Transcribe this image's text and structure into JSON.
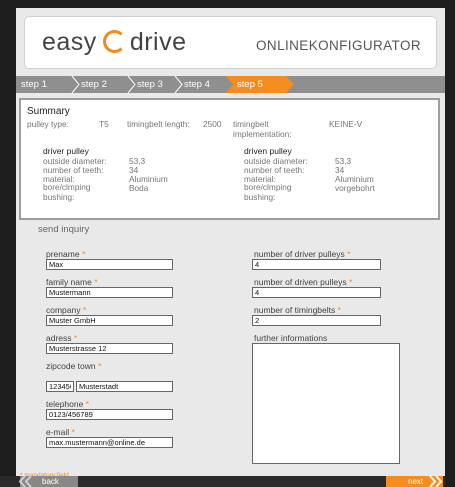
{
  "header": {
    "logo_left": "easy",
    "logo_right": "drive",
    "subtitle": "ONLINEKONFIGURATOR"
  },
  "steps": [
    "step 1",
    "step 2",
    "step 3",
    "step 4",
    "step 5"
  ],
  "active_step": "step 5",
  "summary": {
    "title": "Summary",
    "pulley_type_label": "pulley type:",
    "pulley_type_value": "T5",
    "belt_length_label": "timingbelt length:",
    "belt_length_value": "2500",
    "belt_impl_label": "timingbelt implementation:",
    "belt_impl_value": "KEINE-V",
    "driver": {
      "title": "driver pulley",
      "outside_diameter_label": "outside diameter:",
      "outside_diameter_value": "53,3",
      "teeth_label": "number of teeth:",
      "teeth_value": "34",
      "material_label": "material:",
      "material_value": "Aluminium",
      "bore_label": "bore/clmping bushing:",
      "bore_value": "Boda"
    },
    "driven": {
      "title": "driven pulley",
      "outside_diameter_label": "outside diameter:",
      "outside_diameter_value": "53,3",
      "teeth_label": "number of teeth:",
      "teeth_value": "34",
      "material_label": "material:",
      "material_value": "Aluminium",
      "bore_label": "bore/clmping bushing:",
      "bore_value": "vorgebohrt"
    }
  },
  "inquiry": {
    "title": "send inquiry",
    "required_mark": "*",
    "prename_label": "prename",
    "prename_value": "Max",
    "family_name_label": "family name",
    "family_name_value": "Mustermann",
    "company_label": "company",
    "company_value": "Muster GmbH",
    "address_label": "adress",
    "address_value": "Musterstrasse 12",
    "zip_town_label": "zipcode  town",
    "zip_value": "123456",
    "town_value": "Musterstadt",
    "telephone_label": "telephone",
    "telephone_value": "0123/456789",
    "email_label": "e-mail",
    "email_value": "max.mustermann@online.de",
    "driver_pulleys_label": "number of driver pulleys",
    "driver_pulleys_value": "4",
    "driven_pulleys_label": "number of driven pulleys",
    "driven_pulleys_value": "4",
    "timingbelts_label": "number of timingbelts",
    "timingbelts_value": "2",
    "further_label": "further informations",
    "further_value": "",
    "mandatory_note": "* mandatory field"
  },
  "nav": {
    "back_label": "back",
    "next_label": "next"
  },
  "colors": {
    "accent": "#f58c1e",
    "step_bar": "#8f8f8f",
    "background": "#1e1e1e"
  }
}
